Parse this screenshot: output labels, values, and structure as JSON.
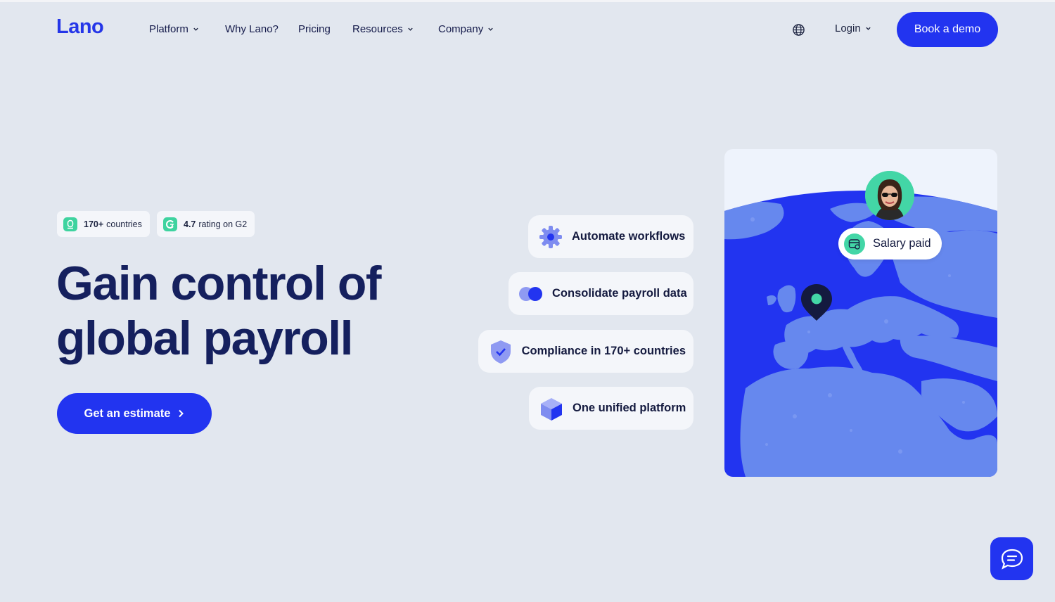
{
  "brand": {
    "logo": "Lano",
    "accent": "#2234f0",
    "text_dark": "#15205e",
    "mint": "#3ed39f"
  },
  "nav": {
    "items": [
      {
        "label": "Platform",
        "has_dropdown": true
      },
      {
        "label": "Why Lano?",
        "has_dropdown": false
      },
      {
        "label": "Pricing",
        "has_dropdown": false
      },
      {
        "label": "Resources",
        "has_dropdown": true
      },
      {
        "label": "Company",
        "has_dropdown": true
      }
    ],
    "language_icon": "globe-icon",
    "login_label": "Login",
    "demo_label": "Book a demo"
  },
  "hero": {
    "badges": [
      {
        "bold": "170+",
        "text": "countries",
        "icon": "location-icon"
      },
      {
        "bold": "4.7",
        "text": "rating on G2",
        "icon": "g2-icon"
      }
    ],
    "headline_line1": "Gain control of",
    "headline_line2": "global payroll",
    "cta_label": "Get an estimate"
  },
  "features": [
    {
      "label": "Automate workflows",
      "icon": "gear-icon"
    },
    {
      "label": "Consolidate payroll data",
      "icon": "toggle-icon"
    },
    {
      "label": "Compliance in 170+ countries",
      "icon": "shield-check-icon"
    },
    {
      "label": "One unified platform",
      "icon": "cube-icon"
    }
  ],
  "map_card": {
    "notification_label": "Salary paid",
    "notification_icon": "card-icon"
  },
  "chat": {
    "icon": "chat-icon"
  }
}
